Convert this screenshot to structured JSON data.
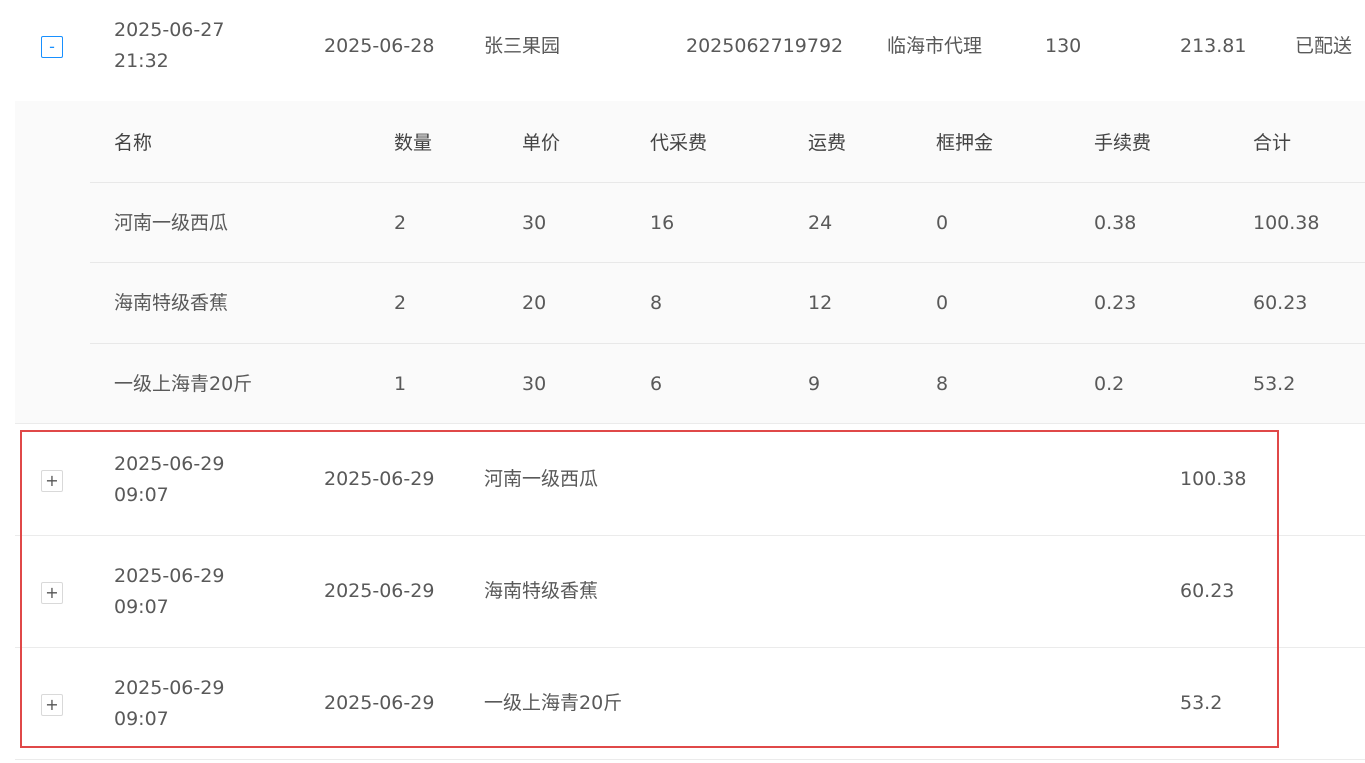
{
  "main_row": {
    "toggle": "-",
    "created_date": "2025-06-27",
    "created_time": "21:32",
    "delivery_date": "2025-06-28",
    "customer": "张三果园",
    "order_no": "2025062719792",
    "agent": "临海市代理",
    "quantity": "130",
    "amount": "213.81",
    "status": "已配送"
  },
  "detail_table": {
    "headers": [
      "名称",
      "数量",
      "单价",
      "代采费",
      "运费",
      "框押金",
      "手续费",
      "合计"
    ],
    "rows": [
      [
        "河南一级西瓜",
        "2",
        "30",
        "16",
        "24",
        "0",
        "0.38",
        "100.38"
      ],
      [
        "海南特级香蕉",
        "2",
        "20",
        "8",
        "12",
        "0",
        "0.23",
        "60.23"
      ],
      [
        "一级上海青20斤",
        "1",
        "30",
        "6",
        "9",
        "8",
        "0.2",
        "53.2"
      ]
    ]
  },
  "collapsed_rows": [
    {
      "toggle": "+",
      "created_date": "2025-06-29",
      "created_time": "09:07",
      "delivery_date": "2025-06-29",
      "product": "河南一级西瓜",
      "amount": "100.38"
    },
    {
      "toggle": "+",
      "created_date": "2025-06-29",
      "created_time": "09:07",
      "delivery_date": "2025-06-29",
      "product": "海南特级香蕉",
      "amount": "60.23"
    },
    {
      "toggle": "+",
      "created_date": "2025-06-29",
      "created_time": "09:07",
      "delivery_date": "2025-06-29",
      "product": "一级上海青20斤",
      "amount": "53.2"
    }
  ],
  "colors": {
    "highlight_border": "#e04848",
    "expand_accent": "#1890ff"
  }
}
